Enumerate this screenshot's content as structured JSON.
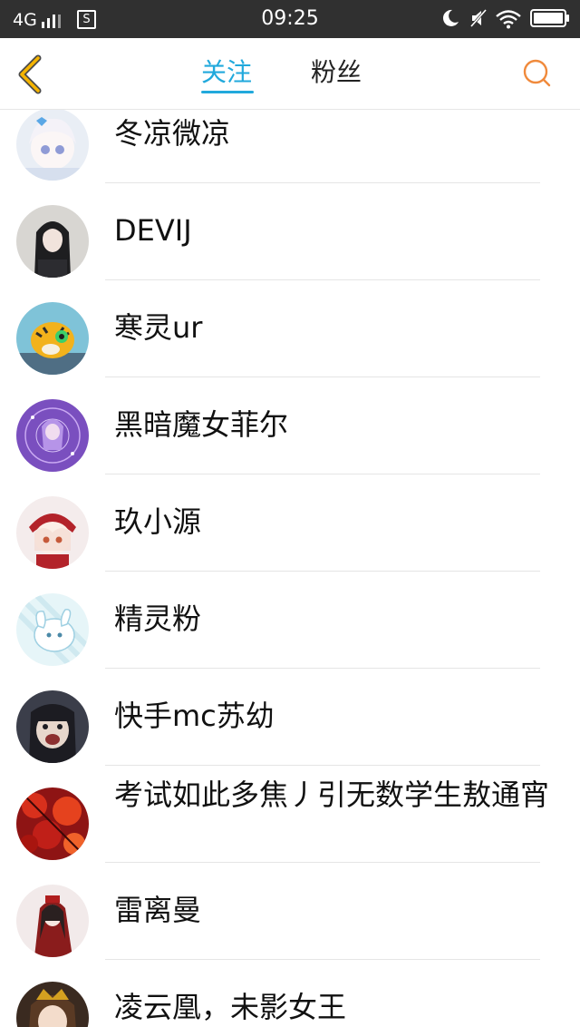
{
  "status_bar": {
    "network": "4G",
    "time": "09:25"
  },
  "header": {
    "tab_following": "关注",
    "tab_fans": "粉丝",
    "active_tab": "关注"
  },
  "list": [
    {
      "name": "冬凉微凉"
    },
    {
      "name": "DEVIJ"
    },
    {
      "name": "寒灵ur"
    },
    {
      "name": "黑暗魔女菲尔"
    },
    {
      "name": "玖小源"
    },
    {
      "name": "精灵粉"
    },
    {
      "name": "快手mc苏幼"
    },
    {
      "name": "考试如此多焦丿引无数学生敖通宵"
    },
    {
      "name": "雷离曼"
    },
    {
      "name": "凌云凰，未影女王"
    }
  ],
  "colors": {
    "accent": "#21a9dc",
    "back_icon": "#f5b400",
    "search_icon": "#f08a3c",
    "status_bar_bg": "#303030"
  }
}
